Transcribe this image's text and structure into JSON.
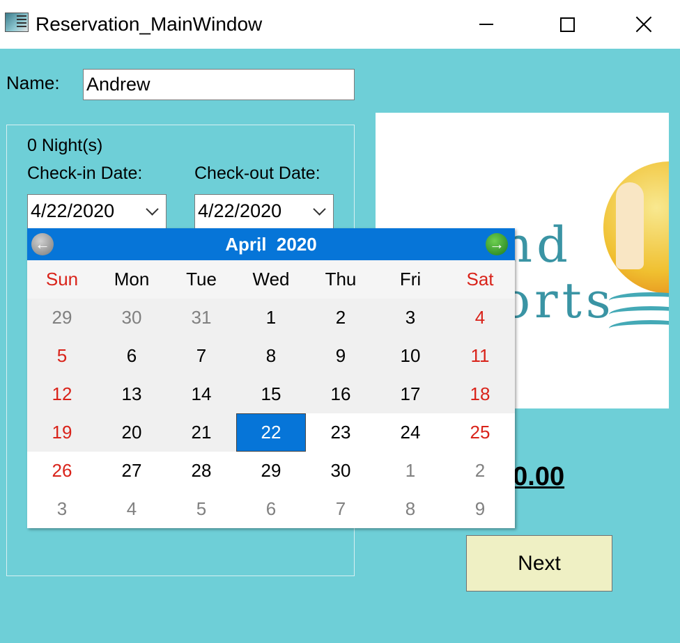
{
  "window": {
    "title": "Reservation_MainWindow",
    "icons": {
      "app": "app-window-icon",
      "minimize": "minimize-icon",
      "maximize": "maximize-icon",
      "close": "close-icon"
    }
  },
  "form": {
    "name_label": "Name:",
    "name_value": "Andrew",
    "nights_text": "0 Night(s)",
    "checkin_label": "Check-in Date:",
    "checkout_label": "Check-out Date:",
    "checkin_value": "4/22/2020",
    "checkout_value": "4/22/2020",
    "price_text": "$0.00",
    "next_label": "Next"
  },
  "logo": {
    "visible_text": "nd orts"
  },
  "calendar": {
    "month": "April",
    "year": "2020",
    "weekdays": [
      "Sun",
      "Mon",
      "Tue",
      "Wed",
      "Thu",
      "Fri",
      "Sat"
    ],
    "weeks": [
      [
        "29",
        "30",
        "31",
        "1",
        "2",
        "3",
        "4"
      ],
      [
        "5",
        "6",
        "7",
        "8",
        "9",
        "10",
        "11"
      ],
      [
        "12",
        "13",
        "14",
        "15",
        "16",
        "17",
        "18"
      ],
      [
        "19",
        "20",
        "21",
        "22",
        "23",
        "24",
        "25"
      ],
      [
        "26",
        "27",
        "28",
        "29",
        "30",
        "1",
        "2"
      ],
      [
        "3",
        "4",
        "5",
        "6",
        "7",
        "8",
        "9"
      ]
    ],
    "selected_day": "22"
  },
  "colors": {
    "window_bg": "#6ecfd7",
    "calendar_header": "#0675d8",
    "weekend_text": "#d9231a",
    "next_button_bg": "#eff0c4"
  }
}
